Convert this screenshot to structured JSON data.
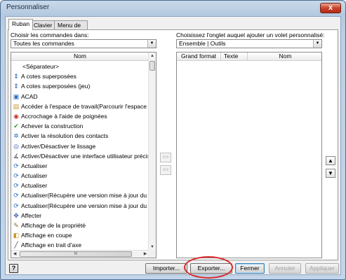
{
  "window": {
    "title": "Personnaliser",
    "close_label": "x"
  },
  "tabs": [
    {
      "label": "Ruban",
      "active": true
    },
    {
      "label": "Clavier",
      "active": false
    },
    {
      "label": "Menu de marquage",
      "active": false
    }
  ],
  "left": {
    "label": "Choisir les commandes dans:",
    "combo_value": "Toutes les commandes",
    "column_header": "Nom",
    "items": [
      {
        "label": "<Séparateur>",
        "icon": "separator"
      },
      {
        "label": "A cotes superposées",
        "icon": "stacked-dims-icon"
      },
      {
        "label": "A cotes superposées (jeu)",
        "icon": "stacked-dims-set-icon"
      },
      {
        "label": "ACAD",
        "icon": "acad-icon"
      },
      {
        "label": "Accéder à l'espace de travail(Parcourir l'espace de travail)",
        "icon": "workspace-icon"
      },
      {
        "label": "Accrochage à l'aide de poignées",
        "icon": "grip-snap-icon"
      },
      {
        "label": "Achever la construction",
        "icon": "checkmark-icon"
      },
      {
        "label": "Activer la résolution des contacts",
        "icon": "contact-icon"
      },
      {
        "label": "Activer/Désactiver le lissage",
        "icon": "smooth-icon"
      },
      {
        "label": "Activer/Désactiver une interface utilisateur précise",
        "icon": "precise-ui-icon"
      },
      {
        "label": "Actualiser",
        "icon": "refresh-icon"
      },
      {
        "label": "Actualiser",
        "icon": "refresh-icon"
      },
      {
        "label": "Actualiser",
        "icon": "refresh-icon"
      },
      {
        "label": "Actualiser(Récupère une version mise à jour du fichier sélectionné)",
        "icon": "refresh-file-icon"
      },
      {
        "label": "Actualiser(Récupère une version mise à jour du fichier sélectionné)",
        "icon": "refresh-file-icon"
      },
      {
        "label": "Affecter",
        "icon": "assign-icon"
      },
      {
        "label": "Affichage de la propriété",
        "icon": "property-icon"
      },
      {
        "label": "Affichage en coupe",
        "icon": "section-view-icon"
      },
      {
        "label": "Affichage en trait d'axe",
        "icon": "centerline-icon"
      }
    ],
    "hscroll_grip": "III"
  },
  "right": {
    "label": "Choisissez l'onglet auquel ajouter un volet personnalisé:",
    "combo_value": "Ensemble | Outils",
    "columns": [
      "Grand format",
      "Texte",
      "Nom"
    ]
  },
  "move_buttons": {
    "add": ">>",
    "remove": "<<"
  },
  "order_buttons": {
    "up": "▲",
    "down": "▼"
  },
  "footer": {
    "help": "?",
    "import": "Importer...",
    "export": "Exporter...",
    "close": "Fermer",
    "cancel": "Annuler",
    "apply": "Appliquer"
  },
  "colors": {
    "highlight": "#d92b2b",
    "titlebar": "#bcd0e6"
  }
}
